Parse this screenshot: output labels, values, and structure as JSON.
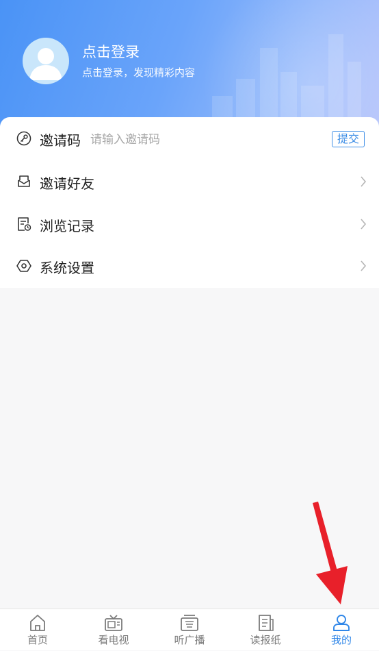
{
  "header": {
    "login_title": "点击登录",
    "login_subtitle": "点击登录，发现精彩内容"
  },
  "menu": {
    "invite_code": {
      "label": "邀请码",
      "placeholder": "请输入邀请码",
      "value": "",
      "submit_label": "提交",
      "icon": "key-icon"
    },
    "items": [
      {
        "label": "邀请好友",
        "icon": "envelope-icon"
      },
      {
        "label": "浏览记录",
        "icon": "history-doc-icon"
      },
      {
        "label": "系统设置",
        "icon": "hexagon-settings-icon"
      }
    ]
  },
  "tabbar": {
    "items": [
      {
        "label": "首页",
        "icon": "home-icon",
        "active": false
      },
      {
        "label": "看电视",
        "icon": "tv-icon",
        "active": false
      },
      {
        "label": "听广播",
        "icon": "radio-icon",
        "active": false
      },
      {
        "label": "读报纸",
        "icon": "newspaper-icon",
        "active": false
      },
      {
        "label": "我的",
        "icon": "user-icon",
        "active": true
      }
    ]
  },
  "colors": {
    "accent": "#2f86e8",
    "tab_inactive": "#7a7a7a",
    "annotation_arrow": "#e8202a"
  }
}
